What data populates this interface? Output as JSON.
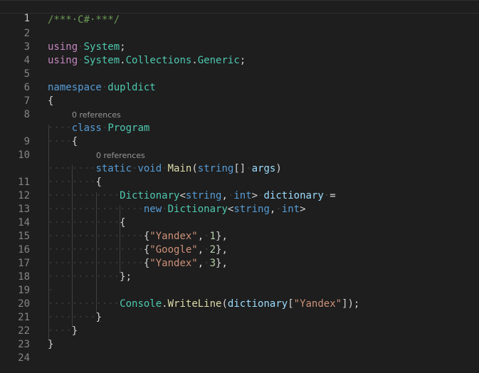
{
  "gutter": {
    "line_numbers": [
      "1",
      "2",
      "3",
      "4",
      "5",
      "6",
      "7",
      "8",
      "9",
      "10",
      "11",
      "12",
      "13",
      "14",
      "15",
      "16",
      "17",
      "18",
      "19",
      "20",
      "21",
      "22",
      "23",
      "24"
    ]
  },
  "codelens": {
    "program_refs": "0 references",
    "main_refs": "0 references"
  },
  "code": {
    "comment": "/***·C#·***/",
    "kw_using": "using",
    "ns_system": "System",
    "ns_collections": "Collections",
    "ns_generic": "Generic",
    "kw_namespace": "namespace",
    "ns_name": "dupldict",
    "kw_class": "class",
    "class_name": "Program",
    "kw_static": "static",
    "kw_void": "void",
    "method_main": "Main",
    "kw_string": "string",
    "kw_int": "int",
    "param_args": "args",
    "type_dictionary": "Dictionary",
    "var_dictionary": "dictionary",
    "kw_new": "new",
    "str_yandex": "\"Yandex\"",
    "str_google": "\"Google\"",
    "num_1": "1",
    "num_2": "2",
    "num_3": "3",
    "type_console": "Console",
    "method_writeline": "WriteLine"
  },
  "colors": {
    "background": "#1e1e1e",
    "keyword": "#569cd6",
    "control_keyword": "#c586c0",
    "type": "#4ec9b0",
    "function": "#dcdcaa",
    "variable": "#9cdcfe",
    "string": "#ce9178",
    "number": "#b5cea8",
    "comment": "#6a9955"
  }
}
